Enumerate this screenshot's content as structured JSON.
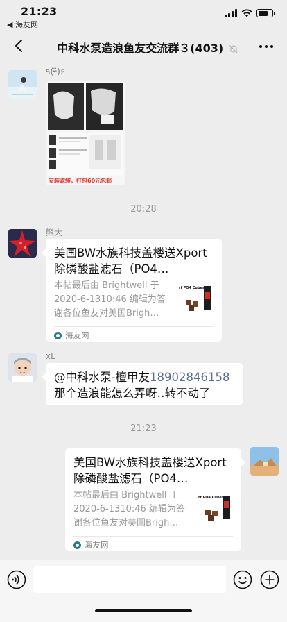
{
  "status_bar": {
    "time": "21:23",
    "back_app": "◀ 海友网"
  },
  "nav": {
    "title": "中科水泵造浪鱼友交流群３(403)"
  },
  "messages": {
    "image_caption": "٩(ᵕ̴̈)۶",
    "image_banner": "安装滤袋，打包60元包邮",
    "timestamp_1": "20:28",
    "sender_1": "熊大",
    "link_1": {
      "title": "美国BW水族科技盖楼送Xport除磷酸盐滤石（PO4…",
      "desc": "本帖最后由 Brightwell 于 2020-6-1310:46 编辑为答谢各位鱼友对美国Brigh…",
      "thumb_text": "rt PO4 Cubes",
      "source": "海友网"
    },
    "sender_2": "xL",
    "text_2_mention": "@中科水泵-檀甲友",
    "text_2_phone": "18902846158",
    "text_2_body": "那个造浪能怎么弄呀‥转不动了",
    "timestamp_2": "21:23",
    "link_2": {
      "title": "美国BW水族科技盖楼送Xport除磷酸盐滤石（PO4…",
      "desc": "本帖最后由 Brightwell 于 2020-6-1310:46 编辑为答谢各位鱼友对美国Brigh…",
      "thumb_text": "rt PO4 Cubes",
      "source": "海友网"
    }
  },
  "input": {
    "placeholder": ""
  },
  "colors": {
    "background": "#ededed",
    "link_blue": "#576b95",
    "bubble": "#ffffff"
  }
}
